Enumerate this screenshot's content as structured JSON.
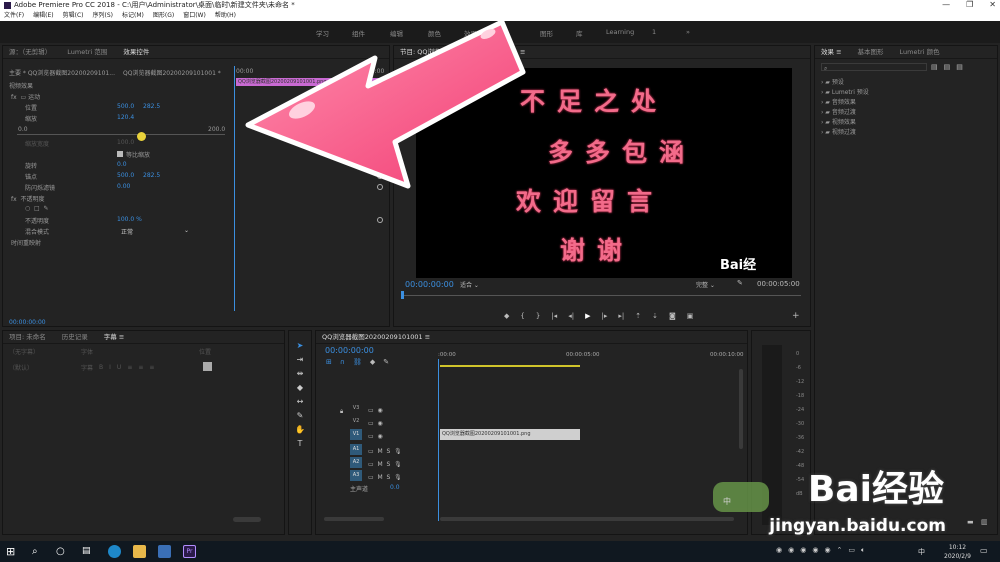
{
  "window": {
    "title": "Adobe Premiere Pro CC 2018 - C:\\用户\\Administrator\\桌面\\临时\\新建文件夹\\未命名 *",
    "min": "—",
    "max": "❐",
    "close": "✕"
  },
  "menu": [
    "文件(F)",
    "编辑(E)",
    "剪辑(C)",
    "序列(S)",
    "标记(M)",
    "图形(G)",
    "窗口(W)",
    "帮助(H)"
  ],
  "workspaces": {
    "items": [
      "学习",
      "组件",
      "编辑",
      "颜色",
      "效果",
      "音频",
      "图形",
      "库",
      "Learning"
    ],
    "badge": "1",
    "overflow": "»"
  },
  "effect_controls": {
    "tabs": [
      "源：（无剪辑）",
      "Lumetri 范围",
      "效果控件",
      "≡"
    ],
    "master": "主要 * QQ浏览器截图20200209101...",
    "clip": "QQ浏览器截图20200209101001 *",
    "time_start": "00:00",
    "time_mid": "00:00",
    "clip_bar": "QQ浏览器截图20200209101001.png",
    "section_video": "视频效果",
    "motion": "运动",
    "position_label": "位置",
    "position_x": "500.0",
    "position_y": "282.5",
    "scale_label": "缩放",
    "scale_val": "120.4",
    "slider_min": "0.0",
    "slider_max": "200.0",
    "scale_width_label": "缩放宽度",
    "scale_width_val": "100.0",
    "uniform_label": "等比缩放",
    "rotation_label": "旋转",
    "rotation_val": "0.0",
    "anchor_label": "锚点",
    "anchor_x": "500.0",
    "anchor_y": "282.5",
    "antiflicker_label": "防闪烁滤镜",
    "antiflicker_val": "0.00",
    "opacity_section": "不透明度",
    "opacity_label": "不透明度",
    "opacity_val": "100.0 %",
    "blend_label": "混合模式",
    "blend_val": "正常",
    "time_remap": "时间重映射",
    "timecode": "00:00:00:00"
  },
  "program_monitor": {
    "title": "节目: QQ浏览器截图20200209101001 ≡",
    "lines": [
      "不足之处",
      "多多包涵",
      "欢迎留言",
      "谢谢"
    ],
    "timecode": "00:00:00:00",
    "fit": "适合",
    "quality": "完整",
    "duration": "00:00:05:00",
    "watermark": "Bai经"
  },
  "project": {
    "tabs": [
      "项目: 未命名",
      "历史记录",
      "字幕 ≡"
    ],
    "placeholder1": "（无字幕）",
    "font_label": "字体",
    "placeholder2": "（默认）",
    "size_label": "字幕",
    "extra": "位置"
  },
  "timeline": {
    "title": "QQ浏览器截图20200209101001 ≡",
    "timecode": "00:00:00:00",
    "ruler": [
      ":00:00",
      "00:00:05:00",
      "00:00:10:00"
    ],
    "tracks": [
      {
        "target": "V3",
        "label": "V3"
      },
      {
        "target": "V2",
        "label": "V2"
      },
      {
        "target": "V1",
        "label": "V1"
      },
      {
        "target": "A1",
        "label": "A1"
      },
      {
        "target": "A2",
        "label": "A2"
      },
      {
        "target": "A3",
        "label": "A3"
      }
    ],
    "master": "主声道",
    "master_val": "0.0",
    "clip": "QQ浏览器截图20200209101001.png"
  },
  "effects_panel": {
    "tabs": [
      "效果 ≡",
      "基本图形",
      "Lumetri 颜色"
    ],
    "items": [
      "预设",
      "Lumetri 预设",
      "音频效果",
      "音频过渡",
      "视频效果",
      "视频过渡"
    ]
  },
  "meter": {
    "labels": [
      "0",
      "-6",
      "-12",
      "-18",
      "-24",
      "-30",
      "-36",
      "-42",
      "-48",
      "-54"
    ],
    "unit": "dB"
  },
  "baidu": {
    "logo": "Bai经验",
    "url": "jingyan.baidu.com",
    "badge": "中"
  },
  "taskbar": {
    "time": "10:12",
    "date": "2020/2/9",
    "lang": "中"
  }
}
